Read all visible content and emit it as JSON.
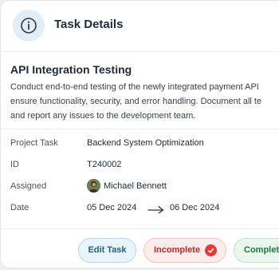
{
  "header": {
    "icon": "info-icon",
    "title": "Task Details"
  },
  "task": {
    "title": "API Integration Testing",
    "description_lines": [
      "Conduct end-to-end testing of the newly integrated payment API",
      "ensure functionality, security, and error handling. Document all te",
      "and report any issues to the development team."
    ]
  },
  "details": {
    "project_label": "Project Task",
    "project_value": "Backend System Optimization",
    "id_label": "ID",
    "id_value": "T240002",
    "assigned_label": "Assigned",
    "assigned_name": "Michael Bennett",
    "date_label": "Date",
    "date_start": "05 Dec 2024",
    "date_end": "06 Dec 2024"
  },
  "actions": {
    "edit_label": "Edit Task",
    "incomplete_label": "Incomplete",
    "complete_label": "Complet"
  },
  "colors": {
    "accent": "#1e5e8f",
    "danger": "#e53935",
    "success": "#1b7a3a"
  }
}
